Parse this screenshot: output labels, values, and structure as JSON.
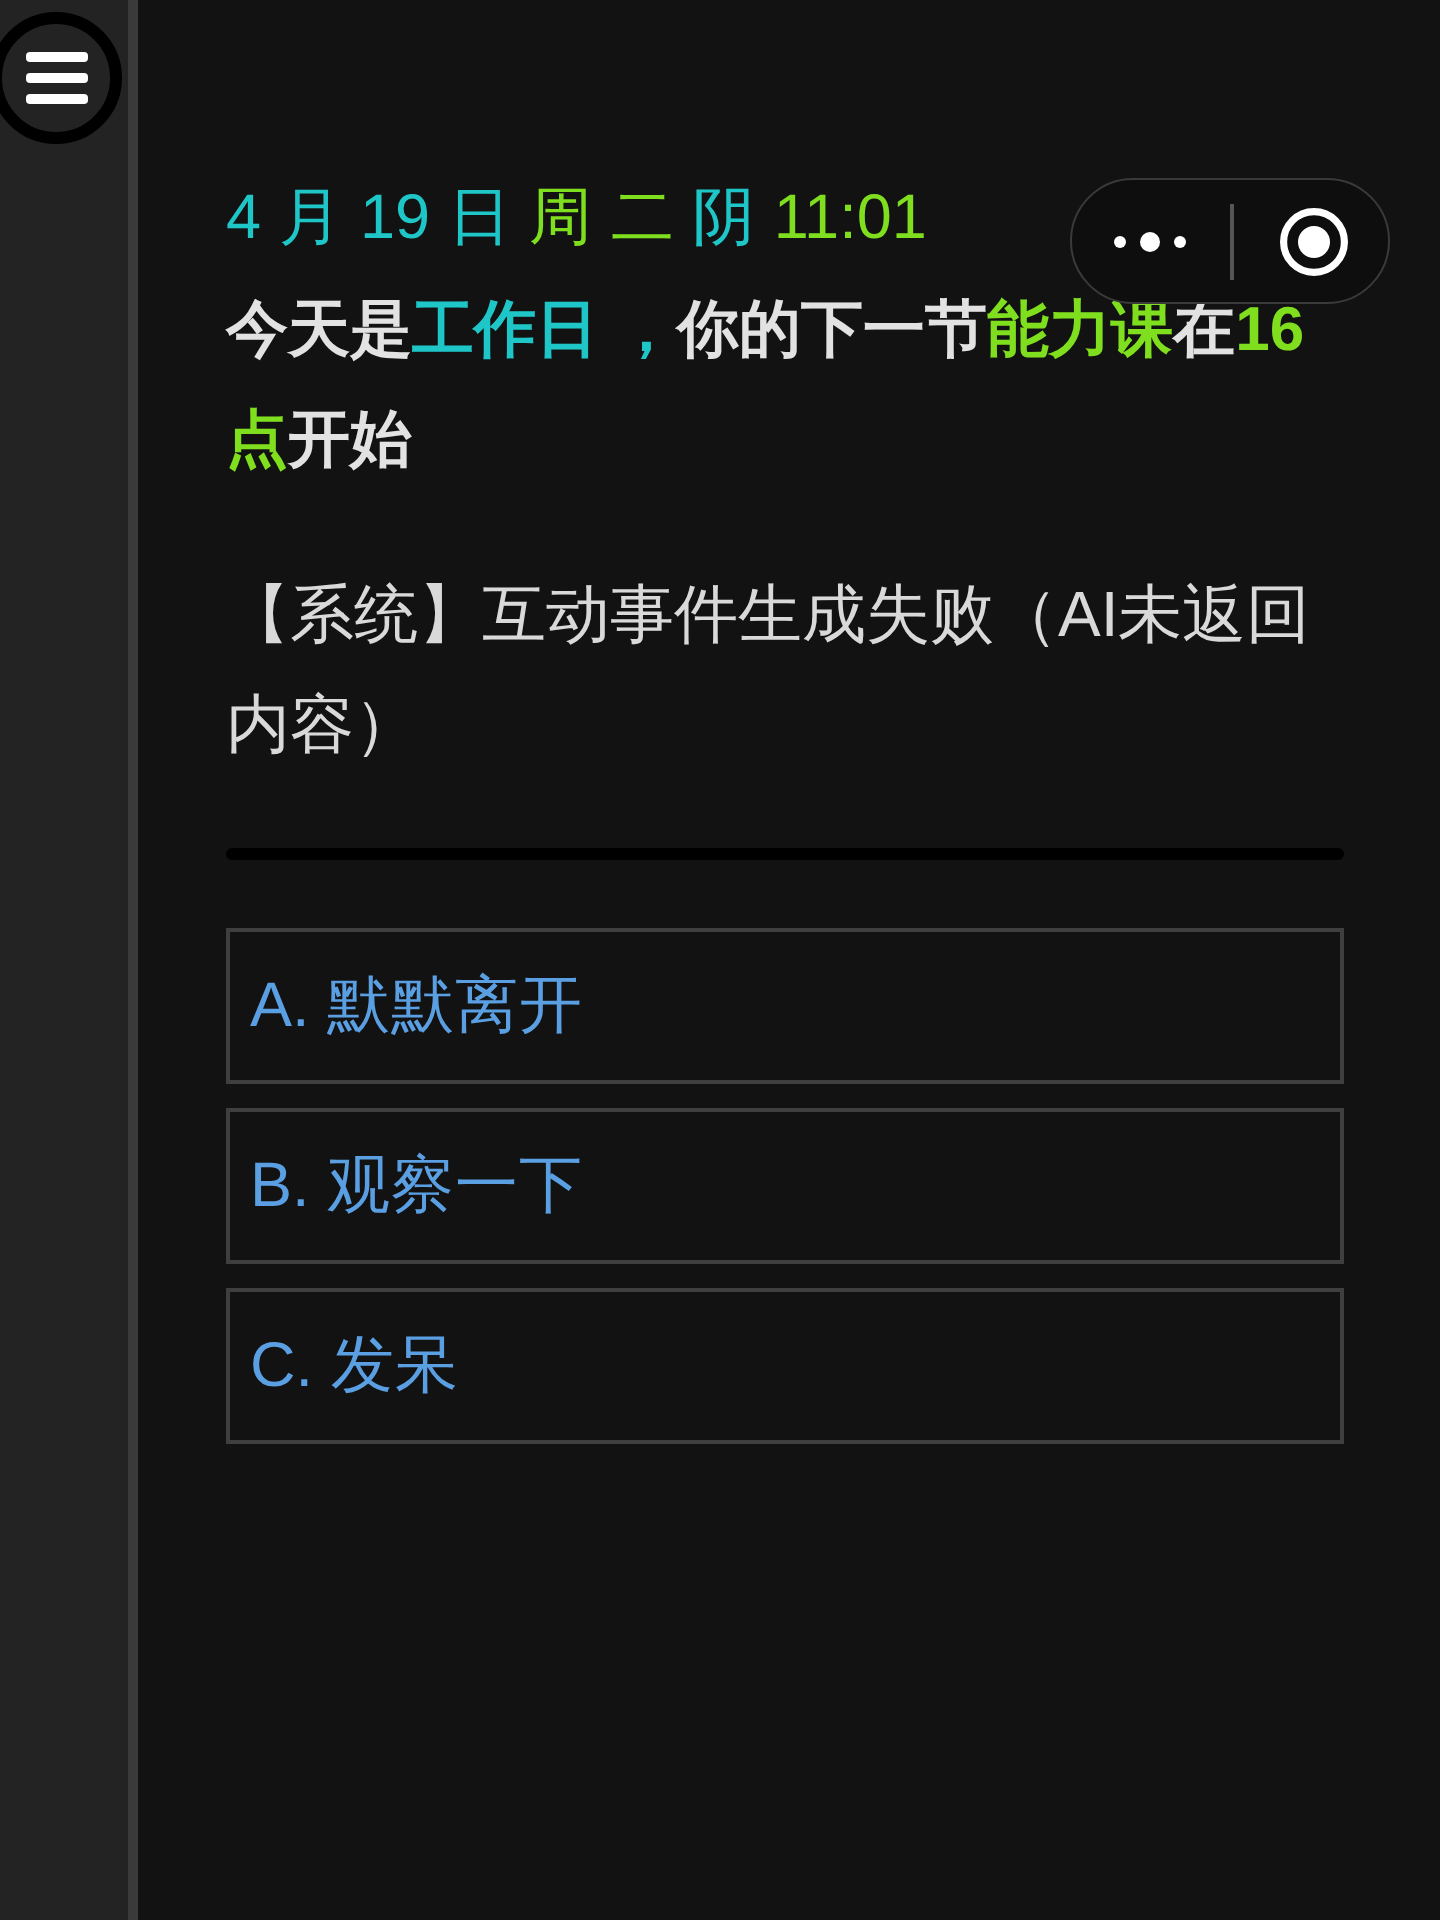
{
  "header": {
    "date_segments": [
      {
        "text": "4 月 19 日",
        "color": "#1fc6c8"
      },
      {
        "text": "周 二",
        "color": "#7fde1e"
      },
      {
        "text": "阴",
        "color": "#1fc6c8"
      },
      {
        "text": "11:01",
        "color": "#7fde1e"
      }
    ],
    "notice_segments": [
      {
        "text": "今天是",
        "color": "#e2e2e2"
      },
      {
        "text": "工作日 ，",
        "color": "#1fc6c8"
      },
      {
        "text": "你的下一节",
        "color": "#e2e2e2"
      },
      {
        "text": "能力课",
        "color": "#7fde1e"
      },
      {
        "text": "在",
        "color": "#e2e2e2"
      },
      {
        "text": "16点",
        "color": "#7fde1e"
      },
      {
        "text": "开始",
        "color": "#e2e2e2"
      }
    ]
  },
  "message": "【系统】互动事件生成失败（AI未返回内容）",
  "choices": [
    "A. 默默离开",
    "B. 观察一下",
    "C. 发呆"
  ]
}
